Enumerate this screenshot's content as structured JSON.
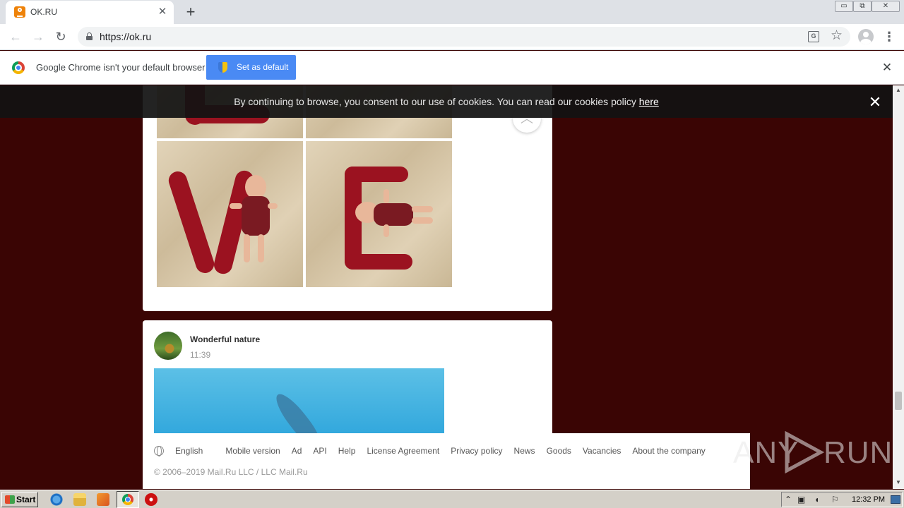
{
  "browser": {
    "tab_title": "OK.RU",
    "tab_close": "✕",
    "new_tab": "+",
    "url": "https://ok.ru",
    "window_buttons": {
      "minimize": "▭",
      "restore": "⧉",
      "close": "✕"
    },
    "nav": {
      "back": "←",
      "forward": "→",
      "reload": "↻"
    },
    "star": "☆",
    "menu": "⋮",
    "translate": "G"
  },
  "infobar": {
    "message": "Google Chrome isn't your default browser",
    "button_label": "Set as default",
    "close": "✕"
  },
  "cookie_banner": {
    "text": "By continuing to browse, you consent to our use of cookies. You can read our cookies policy ",
    "link": "here",
    "close": "✕"
  },
  "feed": {
    "scroll_up": "︿",
    "post": {
      "author": "Wonderful nature",
      "time": "11:39"
    }
  },
  "footer": {
    "language": "English",
    "links": [
      "Mobile version",
      "Ad",
      "API",
      "Help",
      "License Agreement",
      "Privacy policy",
      "News",
      "Goods",
      "Vacancies",
      "About the company"
    ],
    "copyright": "© 2006–2019 Mail.Ru LLC / LLC Mail.Ru"
  },
  "watermark": {
    "left": "ANY",
    "right": "RUN"
  },
  "scrollbar": {
    "up": "▲",
    "down": "▼"
  },
  "taskbar": {
    "start": "Start",
    "clock": "12:32 PM"
  },
  "colors": {
    "page_background": "#3a0504",
    "accent_button": "#4a8af4",
    "ok_orange": "#ee8208"
  },
  "icons": [
    "ok-favicon-icon",
    "lock-icon",
    "translate-icon",
    "star-icon",
    "profile-icon",
    "menu-icon",
    "chrome-logo-icon",
    "shield-icon",
    "globe-icon",
    "chevron-up-icon"
  ]
}
